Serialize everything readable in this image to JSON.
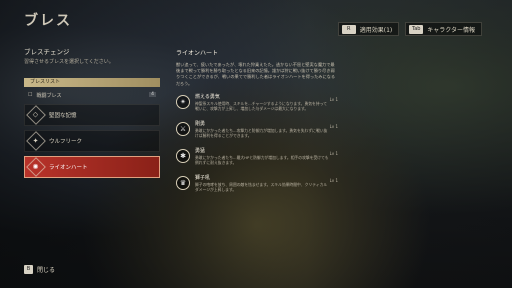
{
  "screen": {
    "title": "ブレス"
  },
  "top_right": {
    "buttons": [
      {
        "key": "R",
        "label": "適用効果(1)"
      },
      {
        "key": "Tab",
        "label": "キャラクター情報"
      }
    ]
  },
  "left": {
    "heading": "ブレスチェンジ",
    "subtitle": "習得させるブレスを選択してください。",
    "list_header": "ブレスリスト",
    "group": {
      "label": "戦闘ブレス",
      "count": "4"
    },
    "items": [
      {
        "icon": "◇",
        "label": "堅固な記憶",
        "selected": false
      },
      {
        "icon": "✦",
        "label": "ウルフリーク",
        "selected": false
      },
      {
        "icon": "✺",
        "label": "ライオンハート",
        "selected": true
      }
    ]
  },
  "detail": {
    "name": "ライオンハート",
    "description": "獣い追って、疲いたであったが、壊れた狩乗えたた。逃かない不屈と堅実な魔力で最後まで戦って勝利を勝ち取ったとなる旧来の記憶。誰かは狩に戦い抜けて勝り尽き弱りつくことができるが、戦いの果てで勝利した者はライオンハートを得ったみになるだろう。",
    "skills": [
      {
        "icon": "✴",
        "name": "燃える勇気",
        "desc": "神聖系スキル使用時、スキルを...チャージするようになります。勇気を持って戦いに、攻撃力が上昇し、増加した与ダメージは最大になります。",
        "level": "Lv 1"
      },
      {
        "icon": "⚔",
        "name": "剛勇",
        "desc": "勇敢にかかった者たち...攻撃力と防御力が増加します。勇気を失わずに戦い抜けば勝利を得ることができます。",
        "level": "Lv 1"
      },
      {
        "icon": "✱",
        "name": "勇猛",
        "desc": "勇敢にかかった者たち...最大HPと防御力が増加します。相手の攻撃を受けても倒れずに耐え抜きます。",
        "level": "Lv 1"
      },
      {
        "icon": "♛",
        "name": "獅子吼",
        "desc": "獅子の咆哮を放ち、周囲の敵を怯ませます。スキル効果時間中、クリティカルダメージが上昇します。",
        "level": "Lv 1"
      }
    ]
  },
  "footer": {
    "close_key": "B",
    "close_label": "閉じる"
  }
}
